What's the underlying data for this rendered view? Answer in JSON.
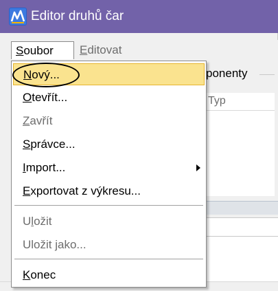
{
  "window": {
    "title": "Editor druhů čar",
    "icon": "line-style-editor-icon"
  },
  "menubar": {
    "items": [
      {
        "label": "Soubor",
        "accel": "S",
        "rest": "oubor",
        "state": "open"
      },
      {
        "label": "Editovat",
        "accel": "E",
        "rest": "ditovat",
        "state": "normal"
      }
    ]
  },
  "dropdown": {
    "items": [
      {
        "label": "Nový...",
        "accel": "N",
        "rest": "ový...",
        "state": "highlighted"
      },
      {
        "label": "Otevřít...",
        "accel": "O",
        "rest": "tevřít...",
        "state": "enabled"
      },
      {
        "label": "Zavřít",
        "accel": "Z",
        "rest": "avřít",
        "state": "disabled"
      },
      {
        "label": "Správce...",
        "accel": "S",
        "rest": "právce...",
        "state": "enabled"
      },
      {
        "label": "Import...",
        "accel": "I",
        "rest": "mport...",
        "state": "enabled",
        "submenu": true
      },
      {
        "label": "Exportovat z výkresu...",
        "accel": "E",
        "rest": "xportovat z výkresu...",
        "state": "enabled"
      },
      {
        "label": "Uložit",
        "pre": "U",
        "accel": "l",
        "rest": "ožit",
        "state": "disabled"
      },
      {
        "label": "Uložit jako...",
        "pre": "Uložit ",
        "accel": "j",
        "rest": "ako...",
        "state": "disabled"
      },
      {
        "label": "Konec",
        "accel": "K",
        "rest": "onec",
        "state": "enabled"
      }
    ]
  },
  "background": {
    "group_label": "ponenty",
    "list_header": "Typ"
  },
  "colors": {
    "titlebar": "#7262a9",
    "highlight_fill": "#fae38f",
    "highlight_border": "#e6b42e",
    "disabled_text": "#6d6d6d"
  }
}
